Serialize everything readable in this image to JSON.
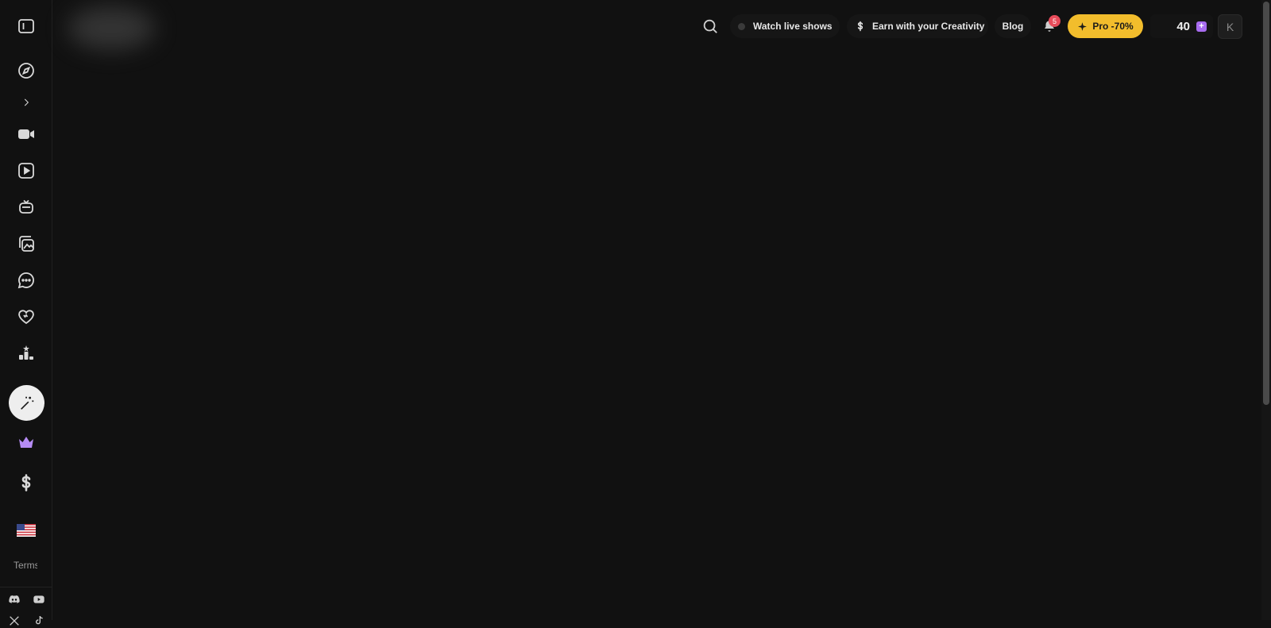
{
  "header": {
    "watch_live_label": "Watch live shows",
    "earn_label": "Earn with your Creativity",
    "blog_label": "Blog",
    "notification_count": "5",
    "pro_label": "Pro -70%",
    "credits": "40",
    "avatar_initial": "K"
  },
  "sidebar": {
    "terms_label": "Terms"
  },
  "colors": {
    "accent_pro": "#f2bd2c",
    "badge": "#e84b5a",
    "credit_plus": "#a86cf0",
    "crown": "#b68cf5"
  }
}
